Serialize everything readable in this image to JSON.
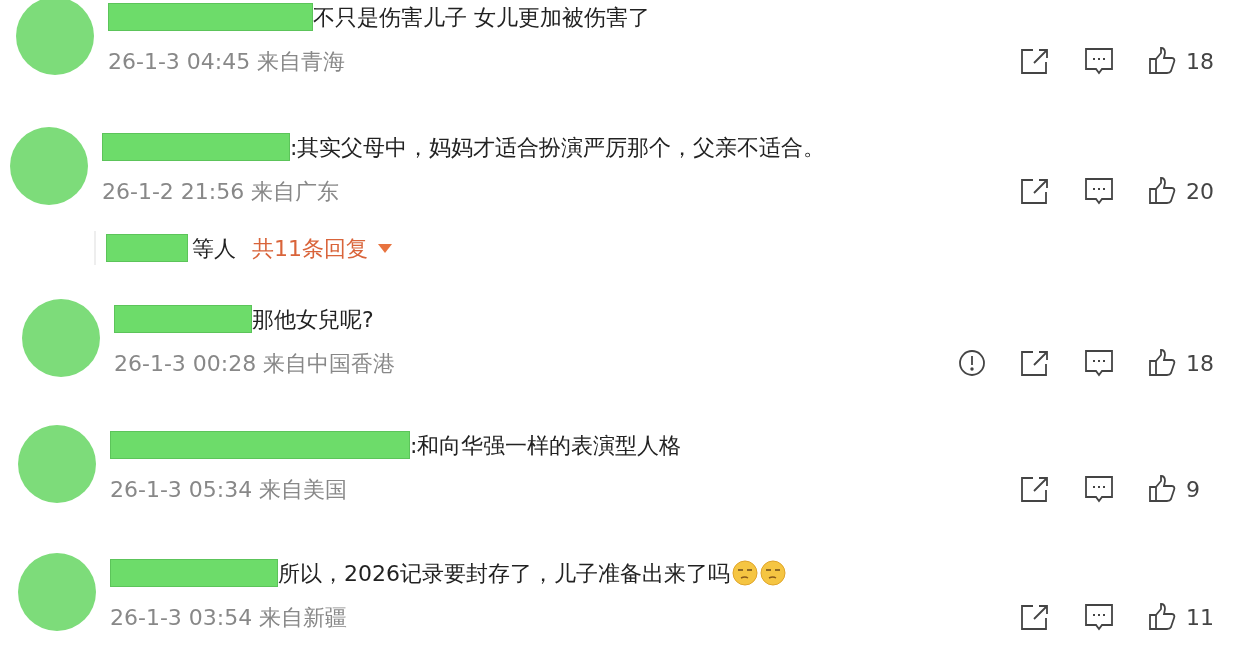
{
  "comments": [
    {
      "text": "不只是伤害儿子 女儿更加被伤害了",
      "time": "26-1-3 04:45",
      "location": "来自青海",
      "likes": "18",
      "report": false
    },
    {
      "text": ":其实父母中，妈妈才适合扮演严厉那个，父亲不适合。",
      "time": "26-1-2 21:56",
      "location": "来自广东",
      "likes": "20",
      "report": false,
      "replies": {
        "suffix": "等人",
        "link": "共11条回复"
      }
    },
    {
      "text": "那他女兒呢?",
      "time": "26-1-3 00:28",
      "location": "来自中国香港",
      "likes": "18",
      "report": true
    },
    {
      "text": ":和向华强一样的表演型人格",
      "time": "26-1-3 05:34",
      "location": "来自美国",
      "likes": "9",
      "report": false
    },
    {
      "text": "所以，2026记录要封存了，儿子准备出来了吗",
      "time": "26-1-3 03:54",
      "location": "来自新疆",
      "likes": "11",
      "report": false,
      "emojis": [
        {
          "kind": "smirk"
        },
        {
          "kind": "smirk"
        }
      ]
    }
  ]
}
